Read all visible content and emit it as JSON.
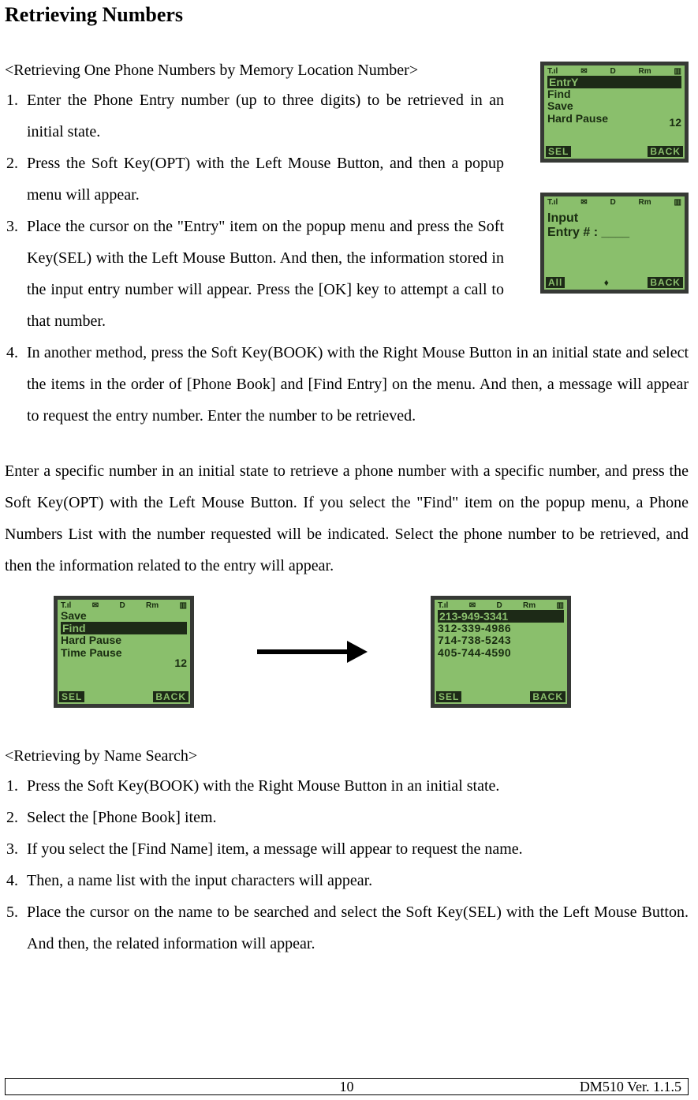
{
  "header": {
    "title": "Retrieving Numbers"
  },
  "section1": {
    "subtitle": "<Retrieving One Phone Numbers by Memory Location Number>",
    "steps": [
      "Enter the Phone Entry number (up to three digits) to be retrieved in an initial state.",
      "Press the Soft Key(OPT) with the Left Mouse Button, and then a popup menu will appear.",
      "Place the cursor on the \"Entry\" item on the popup menu and press the Soft Key(SEL) with the Left Mouse Button. And then, the information stored in the input entry number will appear. Press the [OK] key to attempt a call to that number.",
      "In another method, press the Soft Key(BOOK) with the Right Mouse Button in an initial state and select the items in the order of [Phone Book] and [Find Entry] on the menu. And then, a message will appear to request the entry number. Enter the number to be retrieved."
    ]
  },
  "midparagraph": "Enter a specific number in an initial state to retrieve a phone number with a specific number, and press the Soft Key(OPT) with the Left Mouse Button. If you select the \"Find\" item on the popup menu, a Phone Numbers List with the number requested will be indicated. Select the phone number to be retrieved, and then the information related to the entry will appear.",
  "section2": {
    "subtitle": "<Retrieving by Name Search>",
    "steps": [
      "Press the Soft Key(BOOK) with the Right Mouse Button in an initial state.",
      "Select the [Phone Book] item.",
      "If you select the [Find Name] item, a message will appear to request the name.",
      "Then, a name list with the input characters will appear.",
      "Place the cursor on the name to be searched and select the Soft Key(SEL) with the Left Mouse Button.               And then, the related information will appear."
    ]
  },
  "screens": {
    "statusIcons": {
      "signal": "T.ıl",
      "mail": "✉",
      "d": "D",
      "rm": "Rm",
      "batt": "▥"
    },
    "s1": {
      "menu": [
        "EntrY",
        "Find",
        "Save",
        "Hard Pause"
      ],
      "highlight_index": 0,
      "right_number": "12",
      "footer_left": "SEL",
      "footer_right": "BACK"
    },
    "s2": {
      "line1": "Input",
      "line2": "Entry # : ____",
      "footer_left": "All",
      "footer_mid": "♦",
      "footer_right": "BACK"
    },
    "s3": {
      "menu": [
        "Save",
        "Find",
        "Hard Pause",
        "Time Pause"
      ],
      "highlight_index": 1,
      "right_number": "12",
      "footer_left": "SEL",
      "footer_right": "BACK"
    },
    "s4": {
      "numbers": [
        "213-949-3341",
        "312-339-4986",
        "714-738-5243",
        "405-744-4590"
      ],
      "highlight_index": 0,
      "footer_left": "SEL",
      "footer_right": "BACK"
    }
  },
  "footer": {
    "page": "10",
    "doc": "DM510    Ver. 1.1.5"
  }
}
